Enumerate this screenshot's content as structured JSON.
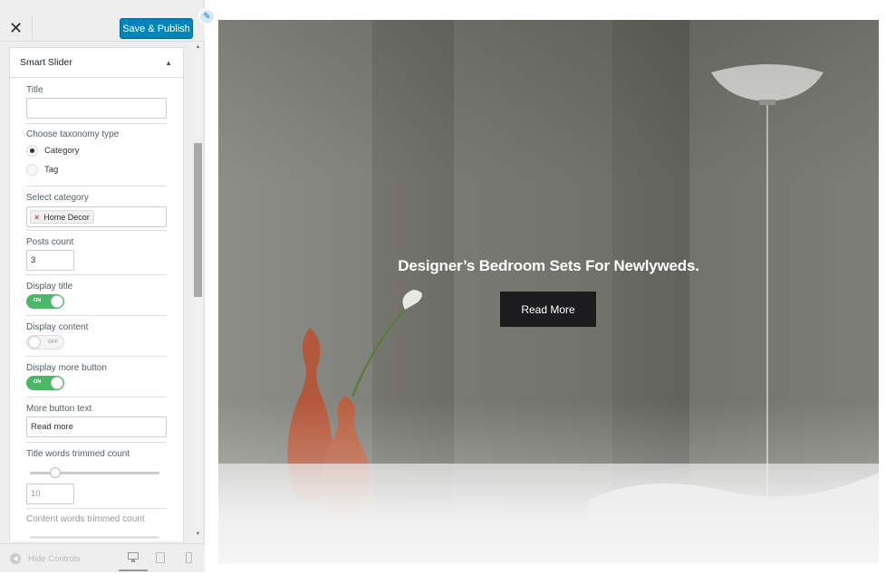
{
  "header": {
    "close_icon": "close-icon",
    "close_glyph": "✕",
    "save_label": "Save & Publish",
    "edit_glyph": "✎"
  },
  "section": {
    "title": "Smart Slider",
    "caret_glyph": "▲"
  },
  "controls": {
    "title_label": "Title",
    "title_value": "",
    "taxonomy_label": "Choose taxonomy type",
    "taxonomy_options": [
      "Category",
      "Tag"
    ],
    "taxonomy_selected": "Category",
    "category_label": "Select category",
    "category_tag": "Home Decor",
    "category_tag_remove": "×",
    "posts_count_label": "Posts count",
    "posts_count_value": "3",
    "display_title_label": "Display title",
    "display_title_state": "ON",
    "display_content_label": "Display content",
    "display_content_state": "OFF",
    "display_more_label": "Display more button",
    "display_more_state": "ON",
    "more_text_label": "More button text",
    "more_text_value": "Read more",
    "title_trim_label": "Title words trimmed count",
    "title_trim_value": "10",
    "content_trim_label": "Content words trimmed count"
  },
  "footer": {
    "hide_label": "Hide Controls",
    "hide_glyph": "◀"
  },
  "scroll": {
    "up_glyph": "▲",
    "down_glyph": "▼"
  },
  "preview": {
    "slide_title": "Designer’s Bedroom Sets For Newlyweds.",
    "button_label": "Read More"
  },
  "colors": {
    "primary": "#0085ba",
    "toggle_on": "#4ab866"
  }
}
